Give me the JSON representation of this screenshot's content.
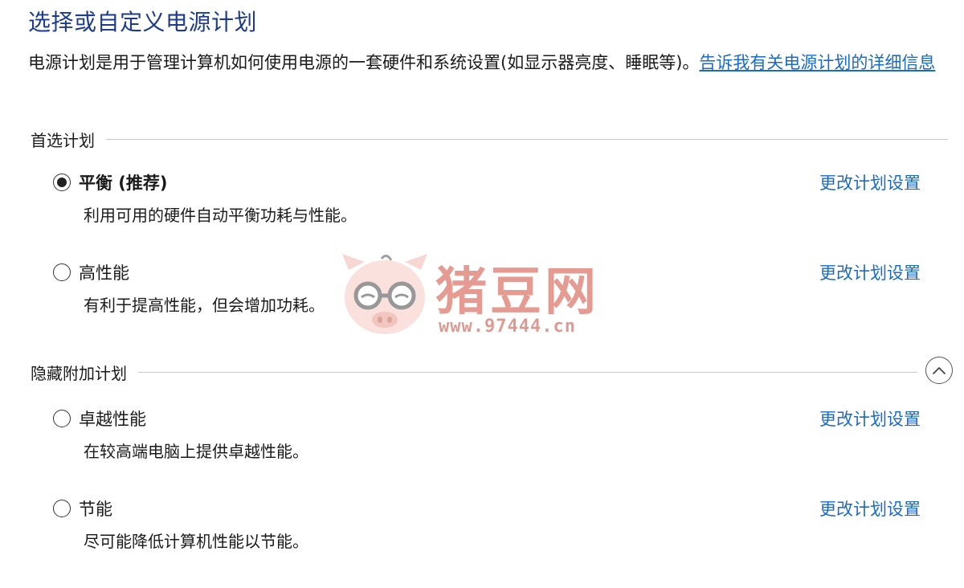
{
  "header": {
    "title": "选择或自定义电源计划",
    "description": "电源计划是用于管理计算机如何使用电源的一套硬件和系统设置(如显示器亮度、睡眠等)。",
    "learn_more_link": "告诉我有关电源计划的详细信息"
  },
  "preferred_group": {
    "label": "首选计划",
    "plans": [
      {
        "name": "平衡 (推荐)",
        "description": "利用可用的硬件自动平衡功耗与性能。",
        "link": "更改计划设置",
        "selected": true
      },
      {
        "name": "高性能",
        "description": "有利于提高性能，但会增加功耗。",
        "link": "更改计划设置",
        "selected": false
      }
    ]
  },
  "hidden_group": {
    "label": "隐藏附加计划",
    "plans": [
      {
        "name": "卓越性能",
        "description": "在较高端电脑上提供卓越性能。",
        "link": "更改计划设置",
        "selected": false
      },
      {
        "name": "节能",
        "description": "尽可能降低计算机性能以节能。",
        "link": "更改计划设置",
        "selected": false
      }
    ]
  },
  "watermark": {
    "brand": "猪豆网",
    "url": "www.97444.cn"
  },
  "colors": {
    "title": "#1e3c8c",
    "link": "#1a6bc8",
    "divider": "#c8c8c8"
  },
  "icons": {
    "collapse": "chevron-up-icon",
    "watermark_logo": "pig-logo-icon"
  }
}
